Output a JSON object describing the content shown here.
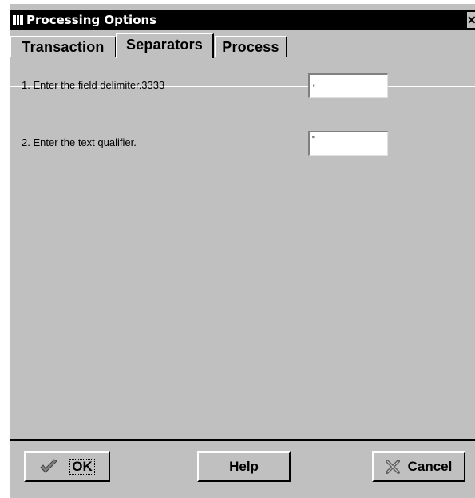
{
  "window": {
    "title": "Processing Options",
    "close_glyph": "✕"
  },
  "tabs": [
    {
      "label": "Transaction",
      "active": false
    },
    {
      "label": "Separators",
      "active": true
    },
    {
      "label": "Process",
      "active": false
    }
  ],
  "options": [
    {
      "prompt": "1. Enter the field delimiter.3333",
      "value": ","
    },
    {
      "prompt": "2. Enter the text qualifier.",
      "value": "\""
    }
  ],
  "buttons": {
    "ok": {
      "accel": "O",
      "rest": "K",
      "icon": "checkmark-icon"
    },
    "help": {
      "accel": "H",
      "rest": "elp"
    },
    "cancel": {
      "accel": "C",
      "rest": "ancel",
      "icon": "cancel-x-icon"
    }
  },
  "colors": {
    "face": "#c0c0c0",
    "titlebar": "#000000",
    "checkmark": "#808080"
  }
}
